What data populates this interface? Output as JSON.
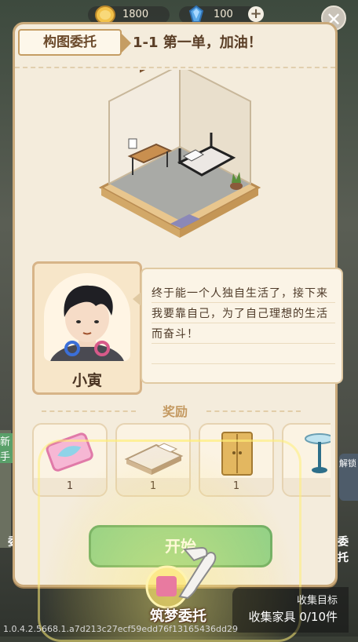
{
  "topbar": {
    "coins": "1800",
    "gems": "100",
    "plus_label": "+",
    "close_label": "✕"
  },
  "panel": {
    "tag": "构图委托",
    "title": "1-1 第一单，加油！"
  },
  "character": {
    "name": "小寅",
    "speech": "终于能一个人独自生活了，接下来我要靠自己，为了自己理想的生活而奋斗！"
  },
  "rewards": {
    "title": "奖励",
    "items": [
      {
        "name": "ticket-reward",
        "count": "1"
      },
      {
        "name": "bed-reward",
        "count": "1"
      },
      {
        "name": "wardrobe-reward",
        "count": "1"
      },
      {
        "name": "lamp-reward",
        "count": ""
      }
    ]
  },
  "actions": {
    "start_label": "开始",
    "dream_label": "筑梦委托"
  },
  "goal": {
    "title": "收集目标",
    "progress": "收集家具 0/10件"
  },
  "side": {
    "left_label": "新手",
    "left_label2": "委",
    "right_label": "解锁",
    "right_label2": "委托"
  },
  "version": "1.0.4.2.5668.1.a7d213c27ecf59edd76f13165436dd29",
  "colors": {
    "panel_bg": "#f4ecdc",
    "panel_border": "#c9a97a",
    "start_button": "#8fd18a",
    "glow": "#fff07a"
  }
}
